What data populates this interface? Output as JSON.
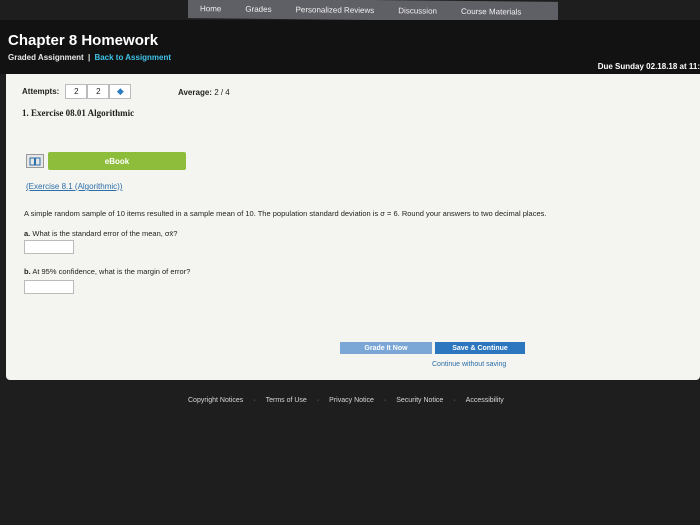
{
  "nav": {
    "items": [
      "Home",
      "Grades",
      "Personalized Reviews",
      "Discussion",
      "Course Materials"
    ]
  },
  "header": {
    "title": "Chapter 8 Homework",
    "assignment_type": "Graded Assignment",
    "separator": "|",
    "back_link": "Back to Assignment",
    "due": "Due Sunday 02.18.18 at 11:"
  },
  "attempts": {
    "label": "Attempts:",
    "used": "2",
    "total": "2",
    "average_label": "Average:",
    "average_value": "2 / 4"
  },
  "exercise": {
    "title": "1. Exercise 08.01 Algorithmic",
    "ebook_label": "eBook",
    "link_text": "(Exercise 8.1 (Algorithmic))",
    "question": "A simple random sample of 10 items resulted in a sample mean of 10. The population standard deviation is σ = 6. Round your answers to two decimal places.",
    "part_a_letter": "a.",
    "part_a_text": "What is the standard error of the mean, σx̄?",
    "part_b_letter": "b.",
    "part_b_text": "At 95% confidence, what is the margin of error?"
  },
  "actions": {
    "grade": "Grade It Now",
    "save": "Save & Continue",
    "continue": "Continue without saving"
  },
  "footer": {
    "items": [
      "Copyright Notices",
      "Terms of Use",
      "Privacy Notice",
      "Security Notice",
      "Accessibility"
    ],
    "dot": "·"
  },
  "colors": {
    "nav_bg": "#5f5f66",
    "link": "#2b6ea8",
    "back_link": "#3fc3e8",
    "ebook_green": "#8dbd3a",
    "save_blue": "#2b76be",
    "grade_blue": "#7aa7d6"
  }
}
